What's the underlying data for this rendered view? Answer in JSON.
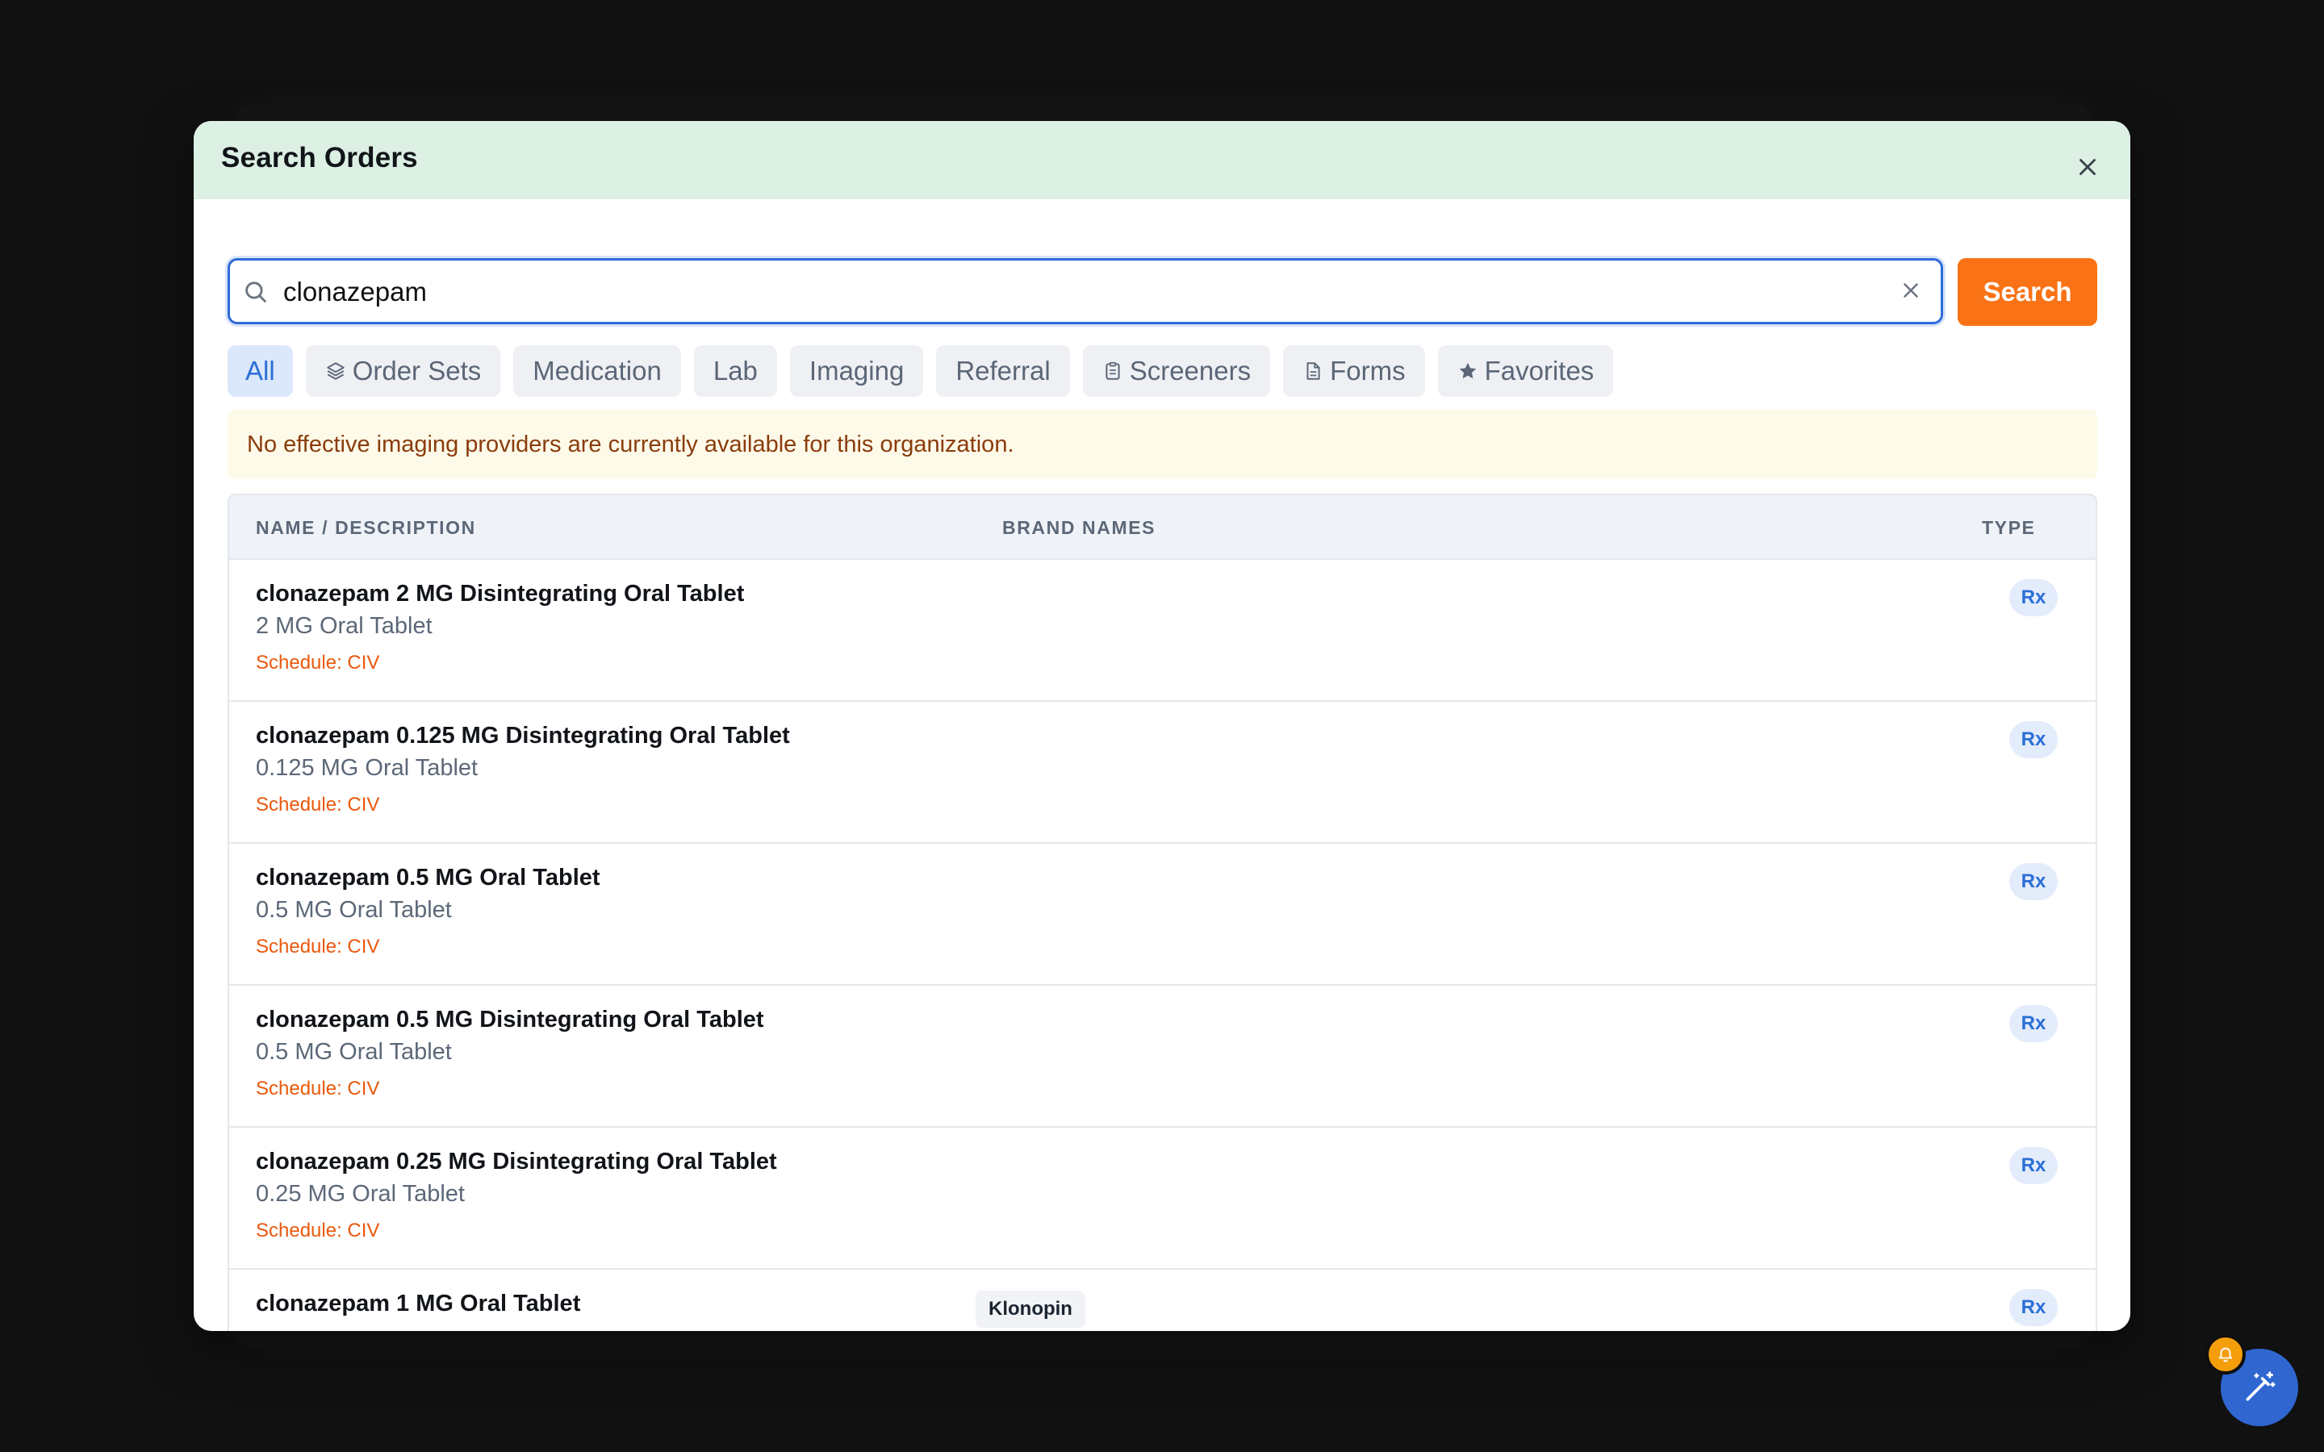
{
  "modal": {
    "title": "Search Orders"
  },
  "search": {
    "value": "clonazepam",
    "button_label": "Search"
  },
  "filters": [
    {
      "label": "All",
      "icon": null,
      "active": true
    },
    {
      "label": "Order Sets",
      "icon": "layers-icon",
      "active": false
    },
    {
      "label": "Medication",
      "icon": null,
      "active": false
    },
    {
      "label": "Lab",
      "icon": null,
      "active": false
    },
    {
      "label": "Imaging",
      "icon": null,
      "active": false
    },
    {
      "label": "Referral",
      "icon": null,
      "active": false
    },
    {
      "label": "Screeners",
      "icon": "clipboard-icon",
      "active": false
    },
    {
      "label": "Forms",
      "icon": "document-icon",
      "active": false
    },
    {
      "label": "Favorites",
      "icon": "star-icon",
      "active": false
    }
  ],
  "alert": {
    "message": "No effective imaging providers are currently available for this organization."
  },
  "table": {
    "headers": {
      "name": "NAME / DESCRIPTION",
      "brand": "BRAND NAMES",
      "type": "TYPE"
    },
    "rows": [
      {
        "name": "clonazepam 2 MG Disintegrating Oral Tablet",
        "desc": "2 MG Oral Tablet",
        "schedule": "Schedule: CIV",
        "brand": "",
        "type": "Rx"
      },
      {
        "name": "clonazepam 0.125 MG Disintegrating Oral Tablet",
        "desc": "0.125 MG Oral Tablet",
        "schedule": "Schedule: CIV",
        "brand": "",
        "type": "Rx"
      },
      {
        "name": "clonazepam 0.5 MG Oral Tablet",
        "desc": "0.5 MG Oral Tablet",
        "schedule": "Schedule: CIV",
        "brand": "",
        "type": "Rx"
      },
      {
        "name": "clonazepam 0.5 MG Disintegrating Oral Tablet",
        "desc": "0.5 MG Oral Tablet",
        "schedule": "Schedule: CIV",
        "brand": "",
        "type": "Rx"
      },
      {
        "name": "clonazepam 0.25 MG Disintegrating Oral Tablet",
        "desc": "0.25 MG Oral Tablet",
        "schedule": "Schedule: CIV",
        "brand": "",
        "type": "Rx"
      },
      {
        "name": "clonazepam 1 MG Oral Tablet",
        "desc": "",
        "schedule": "",
        "brand": "Klonopin",
        "type": "Rx"
      }
    ]
  },
  "colors": {
    "header_bg": "#dcf0e3",
    "accent_orange": "#f97316",
    "accent_blue": "#2b6fd6",
    "schedule_text": "#ea580c"
  }
}
